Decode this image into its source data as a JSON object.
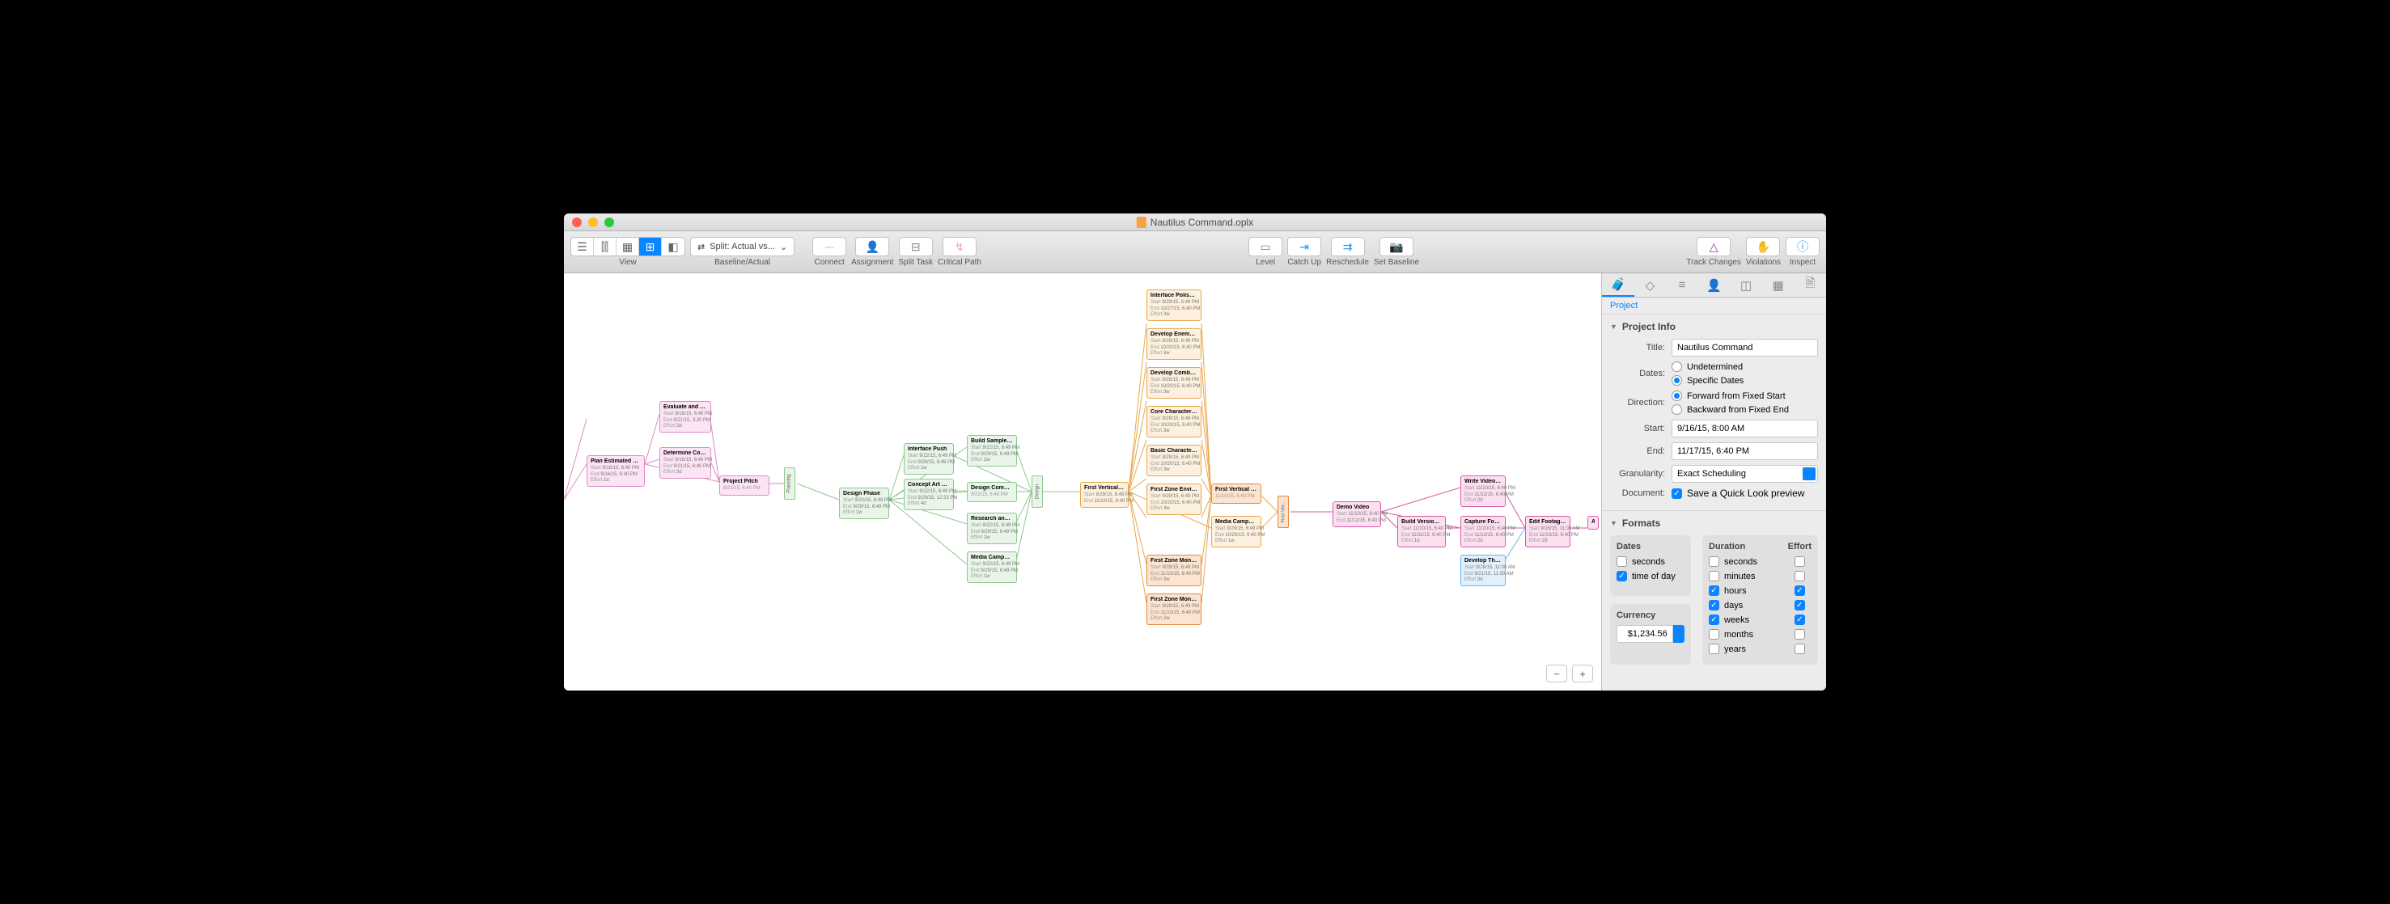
{
  "window": {
    "title": "Nautilus Command.oplx"
  },
  "toolbar": {
    "view_label": "View",
    "baseline_dropdown": "Split: Actual vs...",
    "baseline_label": "Baseline/Actual",
    "connect": "Connect",
    "assignment": "Assignment",
    "split_task": "Split Task",
    "critical_path": "Critical Path",
    "level": "Level",
    "catch_up": "Catch Up",
    "reschedule": "Reschedule",
    "set_baseline": "Set Baseline",
    "track_changes": "Track Changes",
    "violations": "Violations",
    "inspect": "Inspect"
  },
  "nodes": {
    "plan": {
      "t": "Plan Estimated Project...",
      "s": "9/16/15, 6:40 PM",
      "e": "9/16/15, 6:40 PM",
      "f": "1d"
    },
    "eval": {
      "t": "Evaluate and Select M...",
      "s": "9/18/15, 6:40 PM",
      "e": "9/21/15, 3:20 PM",
      "f": "2d"
    },
    "det": {
      "t": "Determine Contractor...",
      "s": "9/16/15, 6:40 PM",
      "e": "9/21/15, 6:40 PM",
      "f": "3d"
    },
    "pitch": {
      "t": "Project Pitch",
      "s": "9/21/15, 6:40 PM"
    },
    "design": {
      "t": "Design Phase",
      "s": "9/22/15, 6:49 PM",
      "e": "9/29/15, 6:49 PM",
      "f": "1w"
    },
    "iface": {
      "t": "Interface Push",
      "s": "9/22/15, 6:49 PM",
      "e": "9/29/15, 6:49 PM",
      "f": "1w"
    },
    "concept": {
      "t": "Concept Art Push",
      "s": "9/22/15, 6:49 PM",
      "e": "9/29/15, 12:23 PM",
      "f": "4d"
    },
    "sample": {
      "t": "Build Sample In-Engine...",
      "s": "9/22/15, 6:49 PM",
      "e": "9/29/15, 6:49 PM",
      "f": "2w"
    },
    "dcomp": {
      "t": "Design Complete",
      "s": "9/22/15, 6:49 PM"
    },
    "research": {
      "t": "Research and Evaluat...",
      "s": "9/22/15, 6:49 PM",
      "e": "9/29/15, 6:49 PM",
      "f": "2w"
    },
    "media": {
      "t": "Media Campaign Phas...",
      "s": "9/22/15, 6:49 PM",
      "e": "9/29/15, 6:49 PM",
      "f": "1w"
    },
    "fvs": {
      "t": "First Vertical Slice",
      "s": "9/29/15, 6:49 PM",
      "e": "11/10/15, 6:40 PM"
    },
    "polish": {
      "t": "Interface Polish Pass",
      "s": "9/29/15, 6:49 PM",
      "e": "10/27/15, 6:40 PM",
      "f": "3w"
    },
    "enemy": {
      "t": "Develop Enemy Pathin...",
      "s": "9/29/15, 6:49 PM",
      "e": "10/20/15, 6:40 PM",
      "f": "3w"
    },
    "combat": {
      "t": "Develop Combat Engin...",
      "s": "9/29/15, 6:49 PM",
      "e": "10/20/15, 6:40 PM",
      "f": "3w"
    },
    "core": {
      "t": "Core Character Art",
      "s": "9/29/15, 6:49 PM",
      "e": "10/20/15, 6:40 PM",
      "f": "3w"
    },
    "anim": {
      "t": "Basic Character Anima...",
      "s": "9/29/15, 6:49 PM",
      "e": "10/20/15, 6:40 PM",
      "f": "3w"
    },
    "zone": {
      "t": "First Zone Environment...",
      "s": "9/29/15, 6:49 PM",
      "e": "10/20/15, 6:40 PM",
      "f": "3w"
    },
    "monster": {
      "t": "First Zone Monster Art",
      "s": "9/29/15, 6:49 PM",
      "e": "11/10/15, 6:40 PM",
      "f": "3w"
    },
    "monster2": {
      "t": "First Zone Monster Ani...",
      "s": "9/29/15, 6:49 PM",
      "e": "11/10/15, 6:40 PM",
      "f": "2w"
    },
    "fvsc": {
      "t": "First Vertical Slice Com...",
      "s": "11/10/15, 6:40 PM"
    },
    "media2": {
      "t": "Media Campaign Phas...",
      "s": "9/29/15, 6:49 PM",
      "e": "10/20/15, 6:40 PM",
      "f": "1w"
    },
    "demo": {
      "t": "Demo Video",
      "s": "11/10/15, 6:40 PM",
      "e": "11/12/15, 6:40 PM"
    },
    "build": {
      "t": "Build Version for Video...",
      "s": "11/10/15, 6:40 PM",
      "e": "11/11/15, 6:40 PM",
      "f": "1d"
    },
    "script": {
      "t": "Write Video Script",
      "s": "11/10/15, 6:40 PM",
      "e": "11/12/15, 6:40 PM",
      "f": "2d"
    },
    "capture": {
      "t": "Capture Footage from...",
      "s": "11/10/15, 6:40 PM",
      "e": "11/12/15, 6:40 PM",
      "f": "2d"
    },
    "edit": {
      "t": "Edit Footage to Theme...",
      "s": "9/16/15, 11:00 AM",
      "e": "11/13/15, 6:40 PM",
      "f": "2d"
    },
    "theme": {
      "t": "Develop Theme Music...",
      "s": "9/16/15, 11:00 AM",
      "e": "9/21/15, 11:00 AM",
      "f": "3d"
    },
    "ad": {
      "t": "Ad..."
    }
  },
  "milestones": {
    "planning": "Planning",
    "design": "Design",
    "firstver": "First Ver..."
  },
  "inspector": {
    "title_label": "Project",
    "sections": {
      "project_info": "Project Info",
      "formats": "Formats"
    },
    "fields": {
      "title_l": "Title:",
      "title_v": "Nautilus Command",
      "dates_l": "Dates:",
      "dates_undet": "Undetermined",
      "dates_spec": "Specific Dates",
      "dir_l": "Direction:",
      "dir_fwd": "Forward from Fixed Start",
      "dir_back": "Backward from Fixed End",
      "start_l": "Start:",
      "start_v": "9/16/15, 8:00 AM",
      "end_l": "End:",
      "end_v": "11/17/15, 6:40 PM",
      "gran_l": "Granularity:",
      "gran_v": "Exact Scheduling",
      "doc_l": "Document:",
      "doc_v": "Save a Quick Look preview"
    },
    "formats": {
      "dates_h": "Dates",
      "seconds": "seconds",
      "tod": "time of day",
      "currency_h": "Currency",
      "currency_v": "$1,234.56",
      "duration_h": "Duration",
      "effort_h": "Effort",
      "u_seconds": "seconds",
      "u_minutes": "minutes",
      "u_hours": "hours",
      "u_days": "days",
      "u_weeks": "weeks",
      "u_months": "months",
      "u_years": "years"
    }
  }
}
